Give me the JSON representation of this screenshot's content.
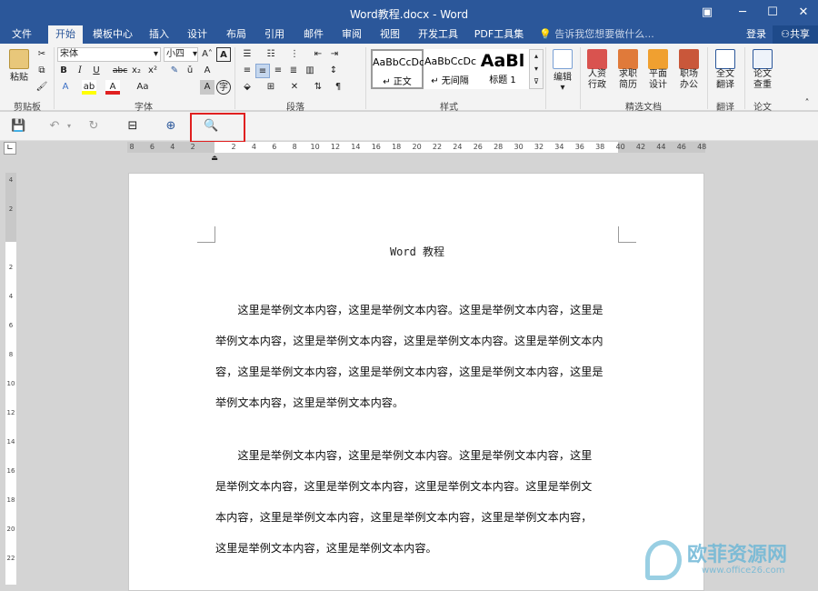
{
  "window": {
    "title": "Word教程.docx - Word",
    "controls": [
      "▣",
      "─",
      "☐",
      "✕"
    ]
  },
  "tabs": [
    "文件",
    "开始",
    "模板中心",
    "插入",
    "设计",
    "布局",
    "引用",
    "邮件",
    "审阅",
    "视图",
    "开发工具",
    "PDF工具集"
  ],
  "tell_me": "告诉我您想要做什么...",
  "login": "登录",
  "share": "共享",
  "ribbon": {
    "clipboard": {
      "paste": "粘贴",
      "label": "剪贴板"
    },
    "font": {
      "name": "宋体",
      "size": "小四",
      "label": "字体"
    },
    "paragraph": {
      "label": "段落"
    },
    "styles": {
      "items": [
        {
          "preview": "AaBbCcDc",
          "name": "↵ 正文"
        },
        {
          "preview": "AaBbCcDc",
          "name": "↵ 无间隔"
        },
        {
          "preview": "AaBl",
          "name": "标题 1"
        }
      ],
      "label": "样式"
    },
    "editing": {
      "label": "编辑"
    },
    "templates": {
      "items": [
        "人资\n行政",
        "求职\n简历",
        "平面\n设计",
        "职场\n办公"
      ],
      "label": "精选文档"
    },
    "translate": {
      "item": "全文\n翻译",
      "label": "翻译"
    },
    "paper": {
      "item": "论文\n查重",
      "label": "论文"
    }
  },
  "ruler_numbers": [
    "8",
    "6",
    "4",
    "2",
    "",
    "2",
    "4",
    "6",
    "8",
    "10",
    "12",
    "14",
    "16",
    "18",
    "20",
    "22",
    "24",
    "26",
    "28",
    "30",
    "32",
    "34",
    "36",
    "38",
    "40",
    "42",
    "44",
    "46",
    "48"
  ],
  "vruler_numbers": [
    "4",
    "2",
    "",
    "2",
    "4",
    "6",
    "8",
    "10",
    "12",
    "14",
    "16",
    "18",
    "20",
    "22"
  ],
  "document": {
    "title": "Word 教程",
    "paragraphs": [
      [
        "　　这里是举例文本内容，这里是举例文本内容。这里是举例文本内容，这里是",
        "举例文本内容，这里是举例文本内容，这里是举例文本内容。这里是举例文本内",
        "容，这里是举例文本内容，这里是举例文本内容，这里是举例文本内容，这里是",
        "举例文本内容，这里是举例文本内容。"
      ],
      [
        "　　这里是举例文本内容，这里是举例文本内容。这里是举例文本内容，这里",
        "是举例文本内容，这里是举例文本内容，这里是举例文本内容。这里是举例文",
        "本内容，这里是举例文本内容，这里是举例文本内容，这里是举例文本内容，",
        "这里是举例文本内容，这里是举例文本内容。"
      ]
    ]
  },
  "watermark": {
    "brand": "欧菲资源网",
    "url": "www.office26.com"
  }
}
